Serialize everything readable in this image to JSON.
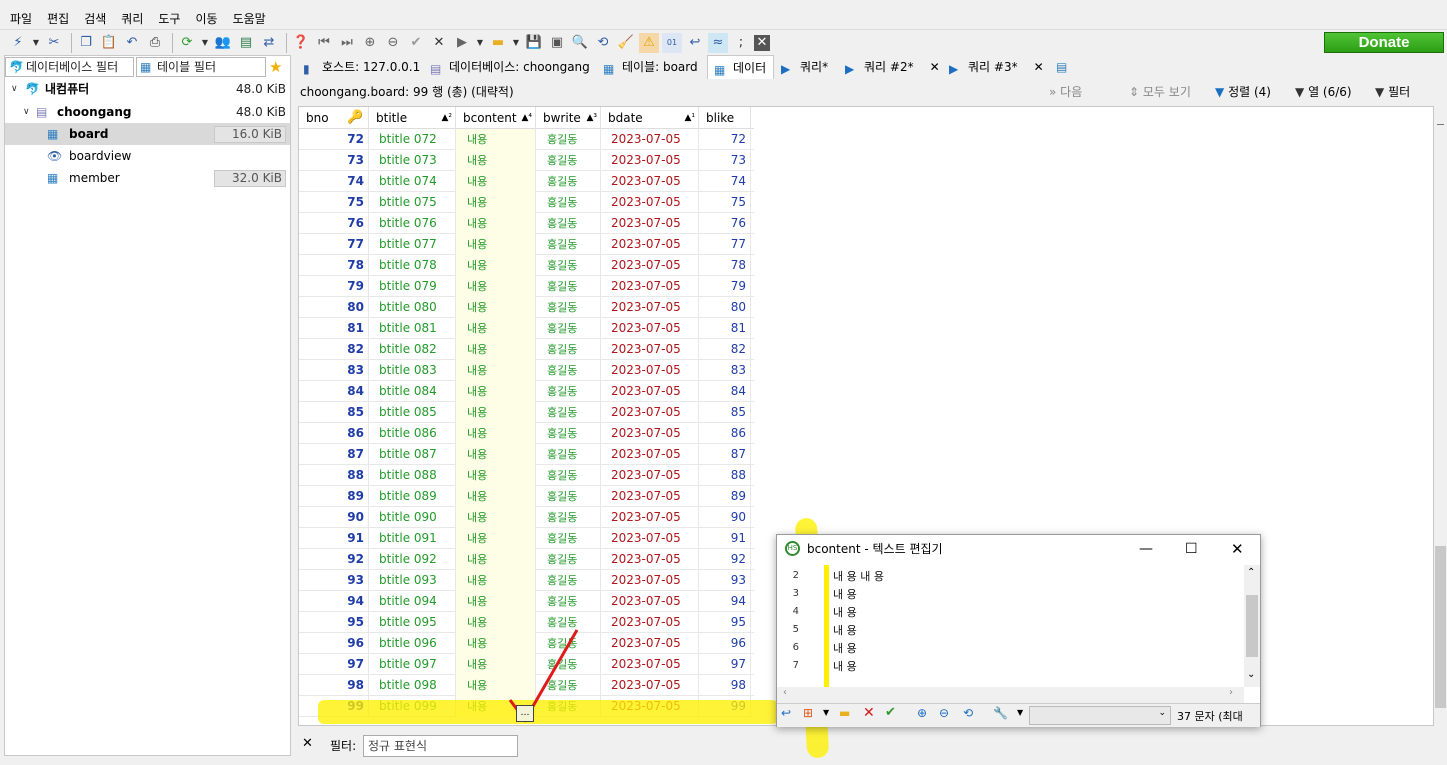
{
  "menu": [
    "파일",
    "편집",
    "검색",
    "쿼리",
    "도구",
    "이동",
    "도움말"
  ],
  "donate_label": "Donate",
  "left": {
    "db_filter_placeholder": "데이터베이스 필터",
    "table_filter_placeholder": "테이블 필터",
    "tree": [
      {
        "label": "내컴퓨터",
        "size": "48.0 KiB"
      },
      {
        "label": "choongang",
        "size": "48.0 KiB"
      },
      {
        "label": "board",
        "size": "16.0 KiB"
      },
      {
        "label": "boardview",
        "size": ""
      },
      {
        "label": "member",
        "size": "32.0 KiB"
      }
    ]
  },
  "tabs": [
    {
      "label": "호스트: 127.0.0.1"
    },
    {
      "label": "데이터베이스: choongang"
    },
    {
      "label": "테이블: board"
    },
    {
      "label": "데이터"
    },
    {
      "label": "쿼리*"
    },
    {
      "label": "쿼리 #2*"
    },
    {
      "label": "쿼리 #3*"
    }
  ],
  "infobar": {
    "summary": "choongang.board: 99 행 (총) (대략적)",
    "next": "다음",
    "show_all": "모두 보기",
    "sort": "정렬 (4)",
    "columns": "열 (6/6)",
    "filter": "필터"
  },
  "grid": {
    "headers": [
      {
        "label": "bno",
        "sort": ""
      },
      {
        "label": "btitle",
        "sort": "▲²"
      },
      {
        "label": "bcontent",
        "sort": "▲⁴"
      },
      {
        "label": "bwrite",
        "sort": "▲³"
      },
      {
        "label": "bdate",
        "sort": "▲¹"
      },
      {
        "label": "blike",
        "sort": ""
      }
    ],
    "rows": [
      [
        "72",
        "btitle 072",
        "내용",
        "홍길동",
        "2023-07-05",
        "72"
      ],
      [
        "73",
        "btitle 073",
        "내용",
        "홍길동",
        "2023-07-05",
        "73"
      ],
      [
        "74",
        "btitle 074",
        "내용",
        "홍길동",
        "2023-07-05",
        "74"
      ],
      [
        "75",
        "btitle 075",
        "내용",
        "홍길동",
        "2023-07-05",
        "75"
      ],
      [
        "76",
        "btitle 076",
        "내용",
        "홍길동",
        "2023-07-05",
        "76"
      ],
      [
        "77",
        "btitle 077",
        "내용",
        "홍길동",
        "2023-07-05",
        "77"
      ],
      [
        "78",
        "btitle 078",
        "내용",
        "홍길동",
        "2023-07-05",
        "78"
      ],
      [
        "79",
        "btitle 079",
        "내용",
        "홍길동",
        "2023-07-05",
        "79"
      ],
      [
        "80",
        "btitle 080",
        "내용",
        "홍길동",
        "2023-07-05",
        "80"
      ],
      [
        "81",
        "btitle 081",
        "내용",
        "홍길동",
        "2023-07-05",
        "81"
      ],
      [
        "82",
        "btitle 082",
        "내용",
        "홍길동",
        "2023-07-05",
        "82"
      ],
      [
        "83",
        "btitle 083",
        "내용",
        "홍길동",
        "2023-07-05",
        "83"
      ],
      [
        "84",
        "btitle 084",
        "내용",
        "홍길동",
        "2023-07-05",
        "84"
      ],
      [
        "85",
        "btitle 085",
        "내용",
        "홍길동",
        "2023-07-05",
        "85"
      ],
      [
        "86",
        "btitle 086",
        "내용",
        "홍길동",
        "2023-07-05",
        "86"
      ],
      [
        "87",
        "btitle 087",
        "내용",
        "홍길동",
        "2023-07-05",
        "87"
      ],
      [
        "88",
        "btitle 088",
        "내용",
        "홍길동",
        "2023-07-05",
        "88"
      ],
      [
        "89",
        "btitle 089",
        "내용",
        "홍길동",
        "2023-07-05",
        "89"
      ],
      [
        "90",
        "btitle 090",
        "내용",
        "홍길동",
        "2023-07-05",
        "90"
      ],
      [
        "91",
        "btitle 091",
        "내용",
        "홍길동",
        "2023-07-05",
        "91"
      ],
      [
        "92",
        "btitle 092",
        "내용",
        "홍길동",
        "2023-07-05",
        "92"
      ],
      [
        "93",
        "btitle 093",
        "내용",
        "홍길동",
        "2023-07-05",
        "93"
      ],
      [
        "94",
        "btitle 094",
        "내용",
        "홍길동",
        "2023-07-05",
        "94"
      ],
      [
        "95",
        "btitle 095",
        "내용",
        "홍길동",
        "2023-07-05",
        "95"
      ],
      [
        "96",
        "btitle 096",
        "내용",
        "홍길동",
        "2023-07-05",
        "96"
      ],
      [
        "97",
        "btitle 097",
        "내용",
        "홍길동",
        "2023-07-05",
        "97"
      ],
      [
        "98",
        "btitle 098",
        "내용",
        "홍길동",
        "2023-07-05",
        "98"
      ],
      [
        "99",
        "btitle 099",
        "내용",
        "홍길동",
        "2023-07-05",
        "99"
      ]
    ]
  },
  "editor": {
    "title": "bcontent - 텍스트 편집기",
    "lines": [
      {
        "n": "2",
        "text": "내 용 내 용"
      },
      {
        "n": "3",
        "text": "내 용"
      },
      {
        "n": "4",
        "text": "내 용"
      },
      {
        "n": "5",
        "text": "내 용"
      },
      {
        "n": "6",
        "text": "내 용"
      },
      {
        "n": "7",
        "text": "내 용"
      }
    ],
    "char_count": "37 문자 (최대"
  },
  "bottom": {
    "filter_label": "필터:",
    "filter_placeholder": "정규 표현식"
  },
  "colors": {
    "number": "#1f3ca8",
    "text": "#239a2a",
    "date": "#b0161a",
    "highlight": "#fff000",
    "donate": "#3db523"
  }
}
